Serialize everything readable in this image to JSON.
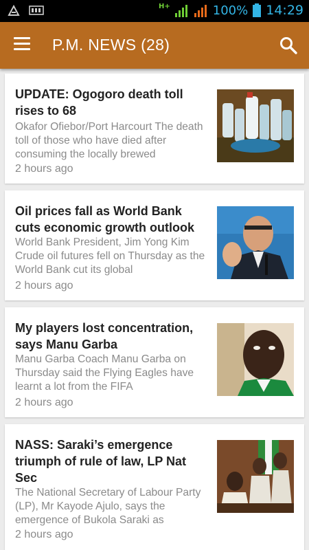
{
  "status_bar": {
    "network_type": "H+",
    "battery_percent": "100%",
    "time": "14:29"
  },
  "app_bar": {
    "title": "P.M. NEWS (28)",
    "menu_icon": "hamburger-menu-icon",
    "search_icon": "search-icon"
  },
  "articles": [
    {
      "title": "UPDATE: Ogogoro death toll rises to 68",
      "snippet": "Okafor Ofiebor/Port Harcourt The death toll of those who have died after consuming the locally brewed",
      "time": "2 hours ago"
    },
    {
      "title": "Oil prices fall as World Bank cuts economic growth outlook",
      "snippet": "World Bank President, Jim Yong Kim Crude oil futures fell on Thursday as the World Bank cut its global",
      "time": "2 hours ago"
    },
    {
      "title": "My players lost concentration, says Manu Garba",
      "snippet": "Manu Garba Coach Manu Garba on Thursday said the Flying Eagles have learnt a lot from the FIFA",
      "time": "2 hours ago"
    },
    {
      "title": "NASS: Saraki’s emergence triumph of rule of law, LP Nat Sec",
      "snippet": "The National Secretary of Labour Party (LP), Mr Kayode Ajulo, says the emergence of Bukola Saraki as",
      "time": "2 hours ago"
    }
  ]
}
